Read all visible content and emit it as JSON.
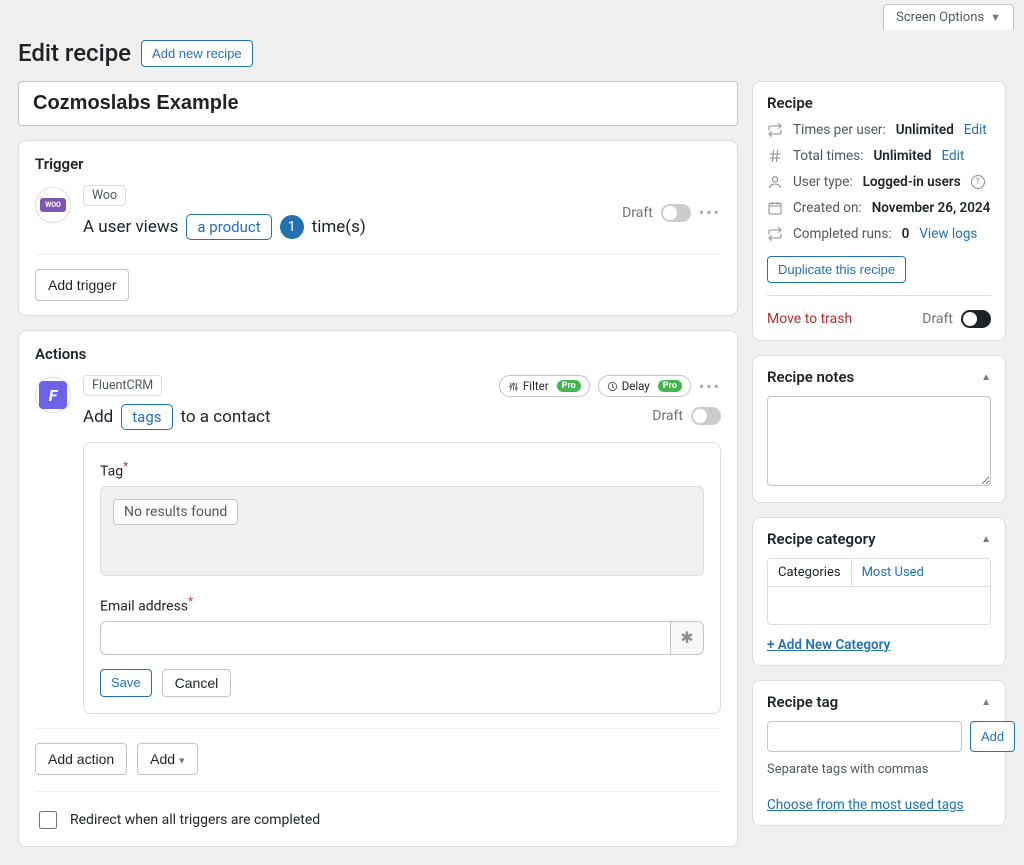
{
  "screen_options_label": "Screen Options",
  "header": {
    "title": "Edit recipe",
    "add_new": "Add new recipe"
  },
  "recipe_title": "Cozmoslabs Example",
  "trigger_section": {
    "title": "Trigger",
    "integration": "Woo",
    "sentence_pre": "A user views",
    "token": "a product",
    "count": "1",
    "sentence_post": "time(s)",
    "status": "Draft",
    "add_trigger": "Add trigger"
  },
  "actions_section": {
    "title": "Actions",
    "integration": "FluentCRM",
    "filter_label": "Filter",
    "filter_pro": "Pro",
    "delay_label": "Delay",
    "delay_pro": "Pro",
    "sentence_pre": "Add",
    "token": "tags",
    "sentence_post": "to a contact",
    "status": "Draft",
    "field_tag_label": "Tag",
    "no_results": "No results found",
    "field_email_label": "Email address",
    "save": "Save",
    "cancel": "Cancel",
    "add_action": "Add action",
    "add": "Add",
    "redirect_label": "Redirect when all triggers are completed"
  },
  "sidebar": {
    "recipe": {
      "title": "Recipe",
      "times_per_user_lbl": "Times per user:",
      "times_per_user_val": "Unlimited",
      "times_per_user_edit": "Edit",
      "total_times_lbl": "Total times:",
      "total_times_val": "Unlimited",
      "total_times_edit": "Edit",
      "user_type_lbl": "User type:",
      "user_type_val": "Logged-in users",
      "created_lbl": "Created on:",
      "created_val": "November 26, 2024",
      "completed_lbl": "Completed runs:",
      "completed_val": "0",
      "view_logs": "View logs",
      "duplicate": "Duplicate this recipe",
      "trash": "Move to trash",
      "draft": "Draft"
    },
    "notes": {
      "title": "Recipe notes"
    },
    "category": {
      "title": "Recipe category",
      "tab_cat": "Categories",
      "tab_most": "Most Used",
      "add_new": "+ Add New Category"
    },
    "tag": {
      "title": "Recipe tag",
      "add": "Add",
      "hint": "Separate tags with commas",
      "choose": "Choose from the most used tags"
    }
  }
}
